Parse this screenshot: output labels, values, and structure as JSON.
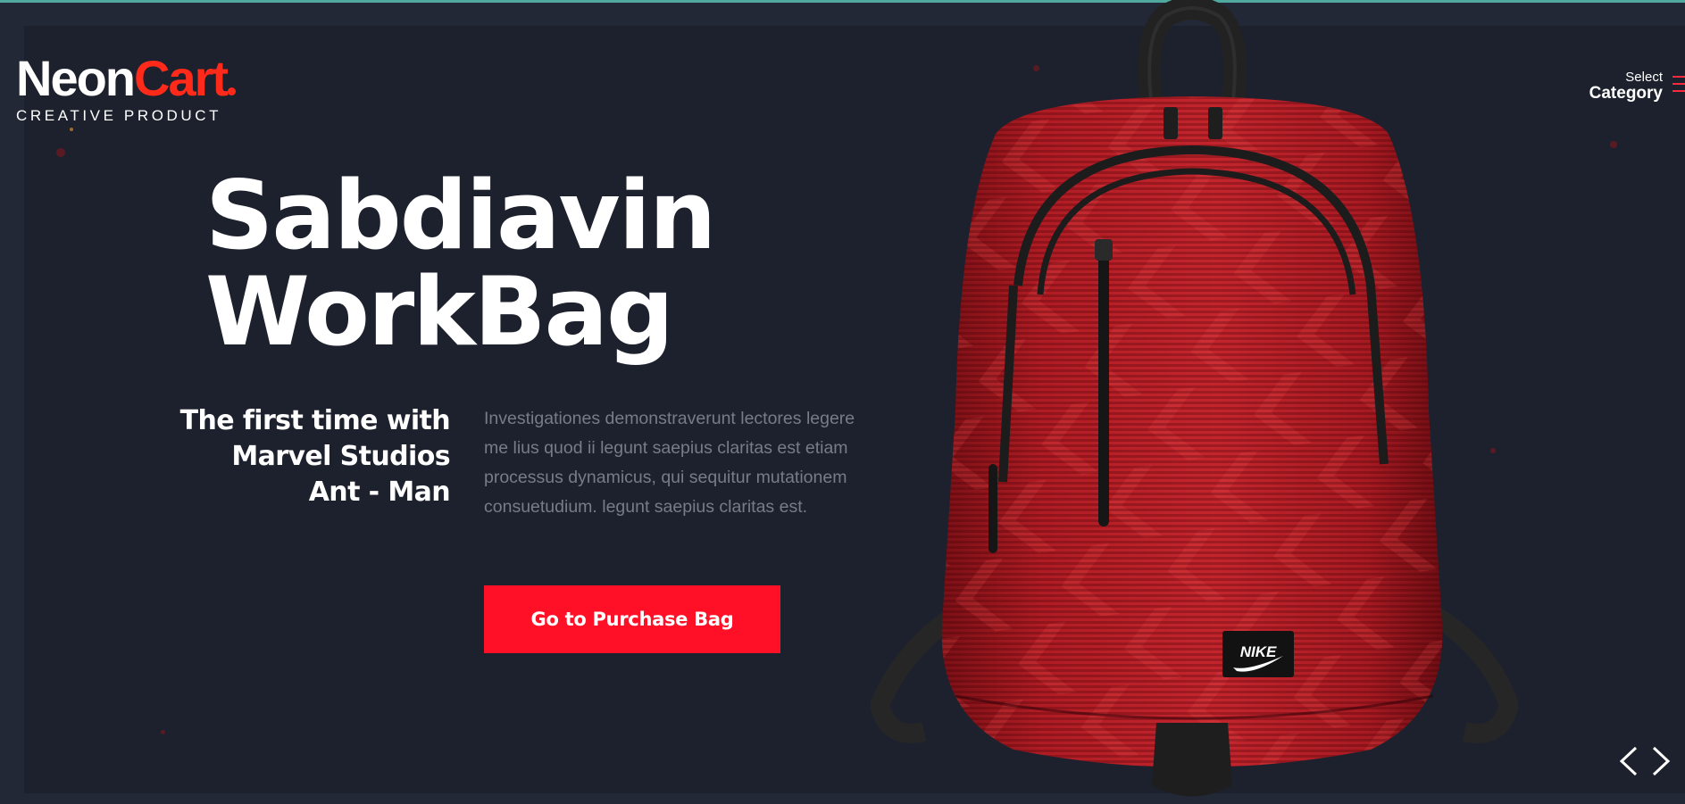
{
  "logo": {
    "word_main": "Neon",
    "word_accent": "Cart",
    "tagline": "CREATIVE PRODUCT"
  },
  "category": {
    "small_label": "Select",
    "big_label": "Category",
    "icon": "hamburger-menu-icon"
  },
  "hero": {
    "title_line1": "Sabdiavin",
    "title_line2": "WorkBag",
    "subtitle_line1": "The first time with",
    "subtitle_line2": "Marvel Studios",
    "subtitle_line3": "Ant - Man",
    "description": "Investigationes demonstraverunt lectores legere me lius quod ii legunt saepius claritas est etiam processus dynamicus, qui sequitur mutationem consuetudium. legunt saepius claritas est.",
    "cta_label": "Go to Purchase Bag"
  },
  "product_image": {
    "badge_text": "NIKE",
    "icon": "backpack-image"
  },
  "slider": {
    "prev_icon": "chevron-left-icon",
    "next_icon": "chevron-right-icon"
  },
  "colors": {
    "background": "#1d212d",
    "accent": "#ff1027",
    "logo_accent": "#ff2a1a",
    "text_muted": "#787c86",
    "top_line": "#4fa99f"
  }
}
